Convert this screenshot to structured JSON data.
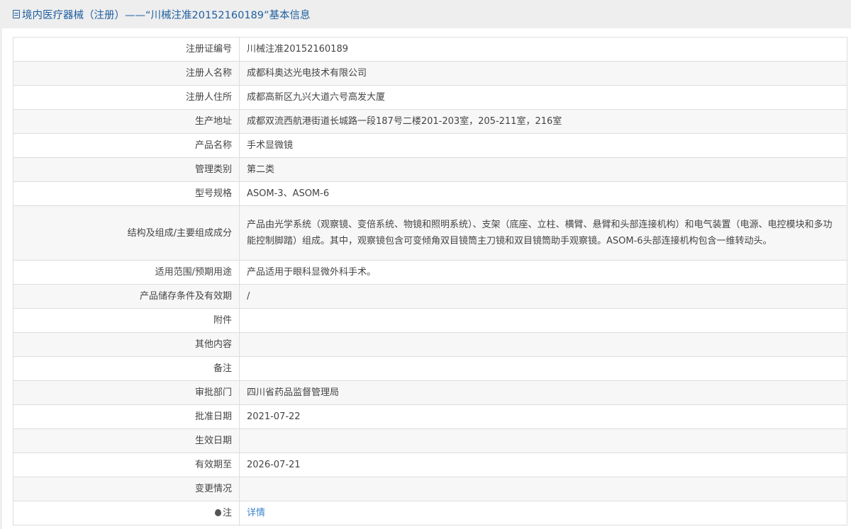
{
  "header": {
    "title": "境内医疗器械（注册）——“川械注准20152160189”基本信息"
  },
  "rows": [
    {
      "label": "注册证编号",
      "value": "川械注准20152160189"
    },
    {
      "label": "注册人名称",
      "value": "成都科奥达光电技术有限公司"
    },
    {
      "label": "注册人住所",
      "value": "成都高新区九兴大道六号高发大厦"
    },
    {
      "label": "生产地址",
      "value": "成都双流西航港街道长城路一段187号二楼201-203室，205-211室，216室"
    },
    {
      "label": "产品名称",
      "value": "手术显微镜"
    },
    {
      "label": "管理类别",
      "value": "第二类"
    },
    {
      "label": "型号规格",
      "value": "ASOM-3、ASOM-6"
    },
    {
      "label": "结构及组成/主要组成成分",
      "value": "产品由光学系统（观察镜、变倍系统、物镜和照明系统）、支架（底座、立柱、横臂、悬臂和头部连接机构）和电气装置（电源、电控模块和多功能控制脚踏）组成。其中，观察镜包含可变倾角双目镜筒主刀镜和双目镜筒助手观察镜。ASOM-6头部连接机构包含一维转动头。"
    },
    {
      "label": "适用范围/预期用途",
      "value": "产品适用于眼科显微外科手术。"
    },
    {
      "label": "产品储存条件及有效期",
      "value": "/"
    },
    {
      "label": "附件",
      "value": ""
    },
    {
      "label": "其他内容",
      "value": ""
    },
    {
      "label": "备注",
      "value": ""
    },
    {
      "label": "审批部门",
      "value": "四川省药品监督管理局"
    },
    {
      "label": "批准日期",
      "value": "2021-07-22"
    },
    {
      "label": "生效日期",
      "value": ""
    },
    {
      "label": "有效期至",
      "value": "2026-07-21"
    },
    {
      "label": "变更情况",
      "value": ""
    }
  ],
  "note": {
    "label": "注",
    "link": "详情",
    "icon": "lightbulb-icon"
  }
}
